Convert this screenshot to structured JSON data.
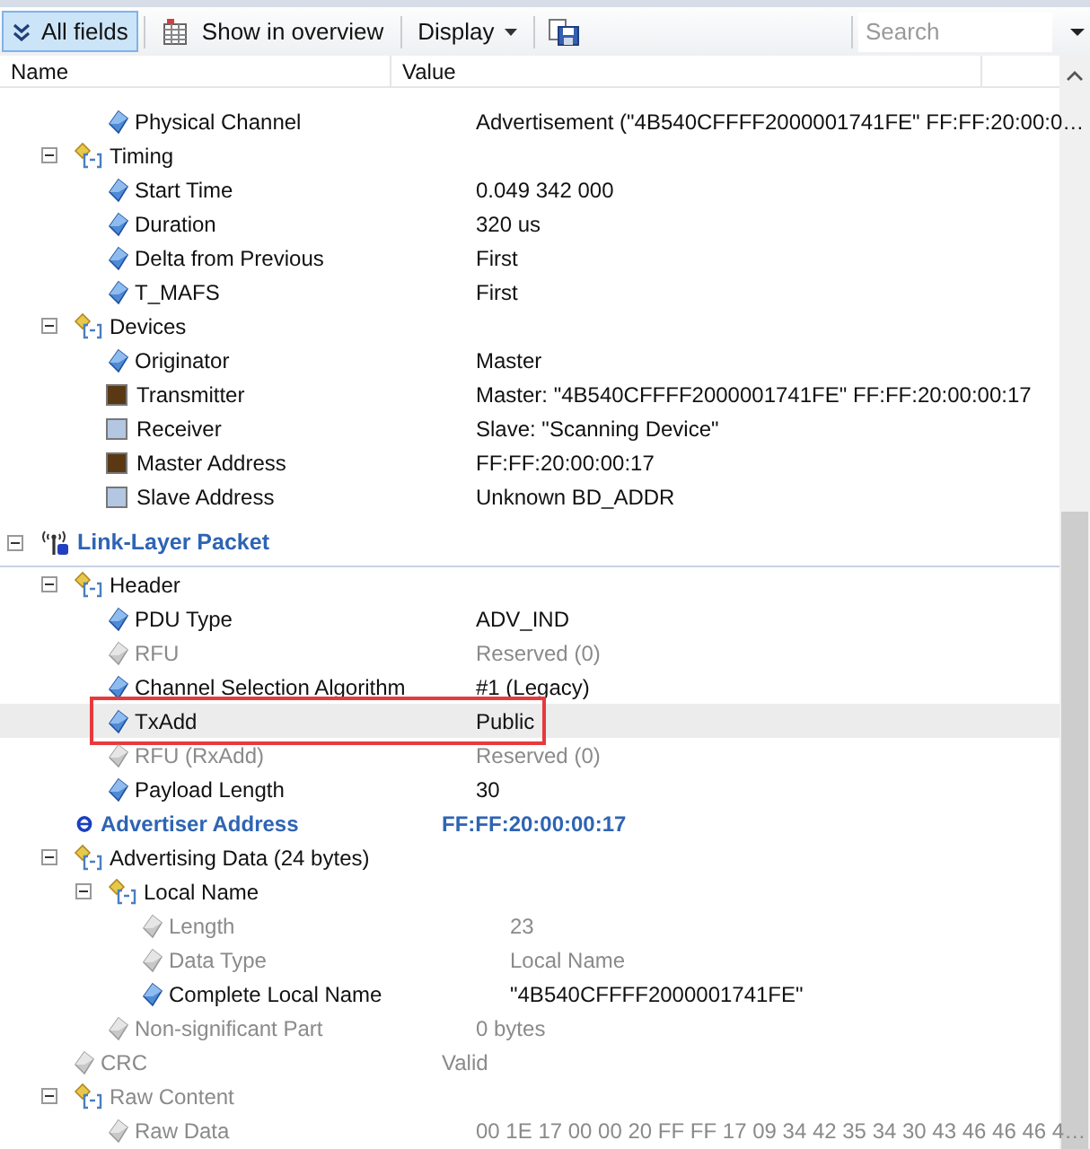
{
  "toolbar": {
    "all_fields": {
      "label": "All fields",
      "selected": true
    },
    "show_in_overview": "Show in overview",
    "display": "Display",
    "search": {
      "placeholder": "Search"
    }
  },
  "columns": [
    "Name",
    "Value"
  ],
  "upper_rows": [
    {
      "kind": "field",
      "name": "Physical Channel",
      "value": "Advertisement (\"4B540CFFFF2000001741FE\" FF:FF:20:00:0…",
      "disabled": false,
      "selected": false
    }
  ],
  "upper_groups": [
    {
      "kind": "group",
      "name": "Timing",
      "expanded": true,
      "disabled": false,
      "selected": false,
      "children": [
        {
          "kind": "field",
          "name": "Start Time",
          "value": "0.049 342 000",
          "disabled": false,
          "selected": false
        },
        {
          "kind": "field",
          "name": "Duration",
          "value": "320 us",
          "disabled": false,
          "selected": false
        },
        {
          "kind": "field",
          "name": "Delta from Previous",
          "value": "First",
          "disabled": false,
          "selected": false
        },
        {
          "kind": "field",
          "name": "T_MAFS",
          "value": "First",
          "disabled": false,
          "selected": false
        }
      ]
    },
    {
      "kind": "group",
      "name": "Devices",
      "expanded": true,
      "disabled": false,
      "selected": false,
      "children": [
        {
          "kind": "field",
          "name": "Originator",
          "value": "Master",
          "disabled": false,
          "selected": false
        },
        {
          "kind": "color",
          "name": "Transmitter",
          "value": "Master: \"4B540CFFFF2000001741FE\" FF:FF:20:00:00:17",
          "color": "#5a3814",
          "disabled": false,
          "selected": false
        },
        {
          "kind": "color",
          "name": "Receiver",
          "value": "Slave: \"Scanning Device\"",
          "color": "#b3c7e3",
          "disabled": false,
          "selected": false
        },
        {
          "kind": "color",
          "name": "Master Address",
          "value": "FF:FF:20:00:00:17",
          "color": "#5a3814",
          "disabled": false,
          "selected": false
        },
        {
          "kind": "color",
          "name": "Slave Address",
          "value": "Unknown BD_ADDR",
          "color": "#b3c7e3",
          "disabled": false,
          "selected": false
        }
      ]
    }
  ],
  "tree": [
    {
      "kind": "packet",
      "name": "Link-Layer Packet",
      "expanded": true,
      "disabled": false,
      "selected": false,
      "children": [
        {
          "kind": "group",
          "name": "Header",
          "expanded": true,
          "disabled": false,
          "selected": false,
          "children": [
            {
              "kind": "field",
              "name": "PDU Type",
              "value": "ADV_IND",
              "disabled": false,
              "selected": false
            },
            {
              "kind": "field",
              "name": "RFU",
              "value": "Reserved (0)",
              "disabled": true,
              "selected": false
            },
            {
              "kind": "field",
              "name": "Channel Selection Algorithm",
              "value": "#1 (Legacy)",
              "disabled": false,
              "selected": false
            },
            {
              "kind": "field",
              "name": "TxAdd",
              "value": "Public",
              "disabled": false,
              "selected": true
            },
            {
              "kind": "field",
              "name": "RFU (RxAdd)",
              "value": "Reserved (0)",
              "disabled": true,
              "selected": false
            },
            {
              "kind": "field",
              "name": "Payload Length",
              "value": "30",
              "disabled": false,
              "selected": false
            }
          ]
        },
        {
          "kind": "address",
          "name": "Advertiser Address",
          "value": "FF:FF:20:00:00:17",
          "disabled": false,
          "selected": false
        },
        {
          "kind": "group",
          "name": "Advertising Data (24 bytes)",
          "expanded": true,
          "disabled": false,
          "selected": false,
          "children": [
            {
              "kind": "group",
              "name": "Local Name",
              "expanded": true,
              "disabled": false,
              "selected": false,
              "children": [
                {
                  "kind": "field",
                  "name": "Length",
                  "value": "23",
                  "disabled": true,
                  "selected": false
                },
                {
                  "kind": "field",
                  "name": "Data Type",
                  "value": "Local Name",
                  "disabled": true,
                  "selected": false
                },
                {
                  "kind": "field",
                  "name": "Complete Local Name",
                  "value": "\"4B540CFFFF2000001741FE\"",
                  "disabled": false,
                  "selected": false
                }
              ]
            },
            {
              "kind": "field",
              "name": "Non-significant Part",
              "value": "0 bytes",
              "disabled": true,
              "selected": false
            }
          ]
        },
        {
          "kind": "field",
          "name": "CRC",
          "value": "Valid",
          "disabled": true,
          "selected": false
        },
        {
          "kind": "group",
          "name": "Raw Content",
          "expanded": true,
          "disabled": true,
          "selected": false,
          "children": [
            {
              "kind": "field",
              "name": "Raw Data",
              "value": "00 1E 17 00 00 20 FF FF 17 09 34 42 35 34 30 43 46 46 46 4…",
              "disabled": true,
              "selected": false
            }
          ]
        }
      ]
    }
  ]
}
